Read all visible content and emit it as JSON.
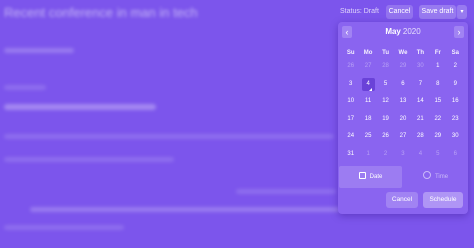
{
  "toolbar": {
    "status_label": "Status:",
    "status_value": "Draft",
    "cancel_label": "Cancel",
    "save_draft_label": "Save draft",
    "caret_icon": "chevron-down-icon"
  },
  "editor": {
    "title": "Recent conference in man in tech"
  },
  "calendar": {
    "month": "May",
    "year": "2020",
    "prev_icon": "chevron-left-icon",
    "next_icon": "chevron-right-icon",
    "weekdays": [
      "Su",
      "Mo",
      "Tu",
      "We",
      "Th",
      "Fr",
      "Sa"
    ],
    "weeks": [
      [
        "26",
        "27",
        "28",
        "29",
        "30",
        "1",
        "2"
      ],
      [
        "3",
        "4",
        "5",
        "6",
        "7",
        "8",
        "9"
      ],
      [
        "10",
        "11",
        "12",
        "13",
        "14",
        "15",
        "16"
      ],
      [
        "17",
        "18",
        "19",
        "20",
        "21",
        "22",
        "23"
      ],
      [
        "24",
        "25",
        "26",
        "27",
        "28",
        "29",
        "30"
      ],
      [
        "31",
        "1",
        "2",
        "3",
        "4",
        "5",
        "6"
      ]
    ],
    "selected_day": "4",
    "date_tab_label": "Date",
    "time_tab_label": "Time",
    "cancel_label": "Cancel",
    "schedule_label": "Schedule"
  },
  "colors": {
    "background": "#7c55ec",
    "popup": "#8a64f0",
    "selected": "#6a42d8"
  }
}
